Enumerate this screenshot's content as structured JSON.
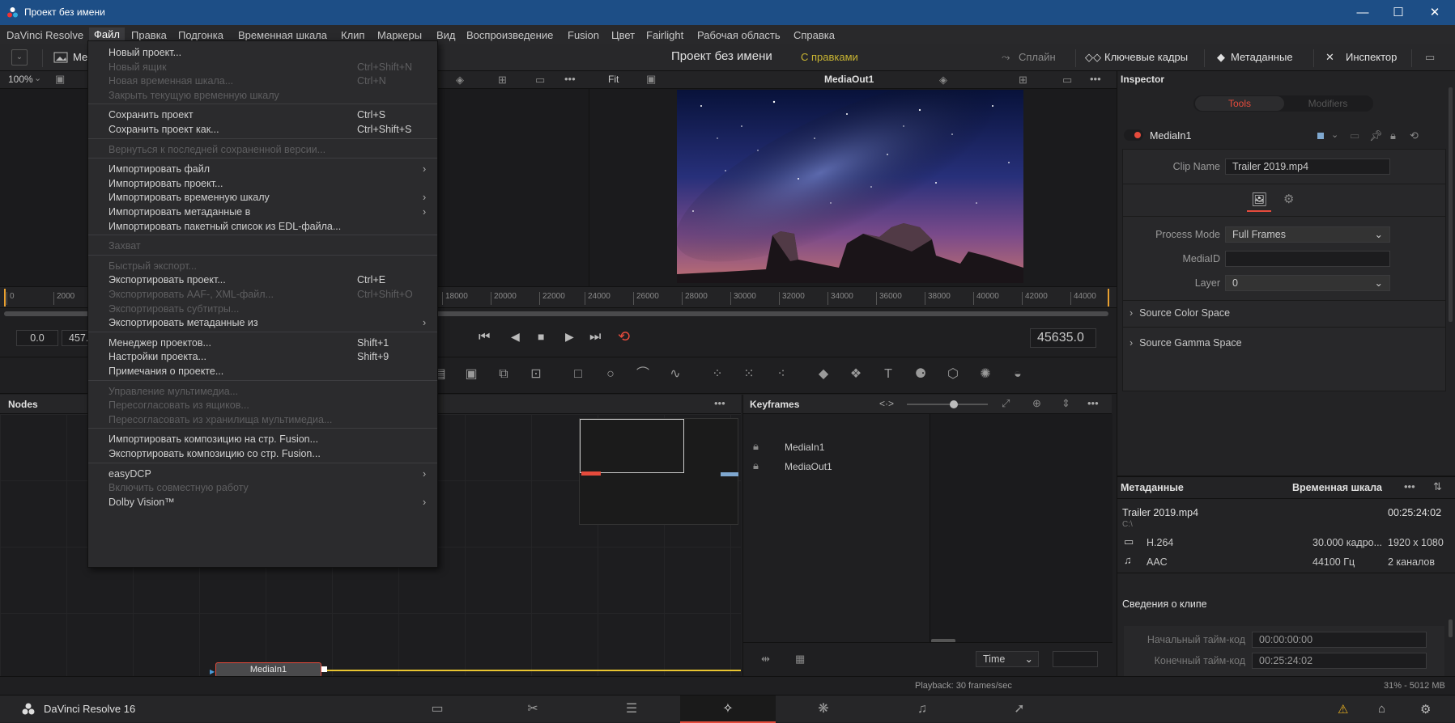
{
  "window": {
    "title": "Проект без имени",
    "min": "—",
    "max": "☐",
    "close": "✕"
  },
  "menu": [
    "DaVinci Resolve",
    "Файл",
    "Правка",
    "Подгонка",
    "Временная шкала",
    "Клип",
    "Маркеры",
    "Вид",
    "Воспроизведение",
    "Fusion",
    "Цвет",
    "Fairlight",
    "Рабочая область",
    "Справка"
  ],
  "toolbar": {
    "media_label": "Ме",
    "project_title": "Проект без имени",
    "edited": "С правками",
    "spline": "Сплайн",
    "keyframes": "Ключевые кадры",
    "metadata": "Метаданные",
    "inspector": "Инспектор"
  },
  "viewer": {
    "zoom": "100%",
    "fit": "Fit",
    "name": "MediaOut1"
  },
  "ruler": [
    "0",
    "2000",
    "18000",
    "20000",
    "22000",
    "24000",
    "26000",
    "28000",
    "30000",
    "32000",
    "34000",
    "36000",
    "38000",
    "40000",
    "42000",
    "44000"
  ],
  "transport": {
    "start": "0.0",
    "end": "457.",
    "timecode": "45635.0"
  },
  "nodes": {
    "title": "Nodes",
    "node": "MediaIn1"
  },
  "keyframes": {
    "title": "Keyframes",
    "items": [
      "MediaIn1",
      "MediaOut1"
    ],
    "time_mode": "Time",
    "toggle": "<·>"
  },
  "inspector": {
    "title": "Inspector",
    "tab_tools": "Tools",
    "tab_modifiers": "Modifiers",
    "node_name": "MediaIn1",
    "clip_name_label": "Clip Name",
    "clip_name": "Trailer 2019.mp4",
    "process_mode_label": "Process Mode",
    "process_mode": "Full Frames",
    "mediaid_label": "MediaID",
    "mediaid": "",
    "layer_label": "Layer",
    "layer": "0",
    "source_color": "Source Color Space",
    "source_gamma": "Source Gamma Space"
  },
  "metadata": {
    "title": "Метаданные",
    "timeline": "Временная шкала",
    "clip": "Trailer 2019.mp4",
    "duration": "00:25:24:02",
    "path": "C:\\",
    "video_codec": "H.264",
    "fps": "30.000 кадро...",
    "resolution": "1920 x 1080",
    "audio_codec": "AAC",
    "sample_rate": "44100 Гц",
    "channels": "2 каналов",
    "section": "Сведения о клипе",
    "start_tc_label": "Начальный тайм-код",
    "start_tc": "00:00:00:00",
    "end_tc_label": "Конечный тайм-код",
    "end_tc": "00:25:24:02"
  },
  "status": {
    "playback": "Playback: 30 frames/sec",
    "mem": "31% - 5012 MB",
    "app": "DaVinci Resolve 16"
  },
  "file_menu": [
    {
      "label": "Новый проект...",
      "shortcut": "",
      "enabled": true,
      "arrow": false
    },
    {
      "label": "Новый ящик",
      "shortcut": "Ctrl+Shift+N",
      "enabled": false,
      "arrow": false
    },
    {
      "label": "Новая временная шкала...",
      "shortcut": "Ctrl+N",
      "enabled": false,
      "arrow": false
    },
    {
      "label": "Закрыть текущую временную шкалу",
      "shortcut": "",
      "enabled": false,
      "arrow": false
    },
    {
      "sep": true
    },
    {
      "label": "Сохранить проект",
      "shortcut": "Ctrl+S",
      "enabled": true,
      "arrow": false
    },
    {
      "label": "Сохранить проект как...",
      "shortcut": "Ctrl+Shift+S",
      "enabled": true,
      "arrow": false
    },
    {
      "sep": true
    },
    {
      "label": "Вернуться к последней сохраненной версии...",
      "shortcut": "",
      "enabled": false,
      "arrow": false
    },
    {
      "sep": true
    },
    {
      "label": "Импортировать файл",
      "shortcut": "",
      "enabled": true,
      "arrow": true
    },
    {
      "label": "Импортировать проект...",
      "shortcut": "",
      "enabled": true,
      "arrow": false
    },
    {
      "label": "Импортировать временную шкалу",
      "shortcut": "",
      "enabled": true,
      "arrow": true
    },
    {
      "label": "Импортировать метаданные в",
      "shortcut": "",
      "enabled": true,
      "arrow": true
    },
    {
      "label": "Импортировать пакетный список из EDL-файла...",
      "shortcut": "",
      "enabled": true,
      "arrow": false
    },
    {
      "sep": true
    },
    {
      "label": "Захват",
      "shortcut": "",
      "enabled": false,
      "arrow": false
    },
    {
      "sep": true
    },
    {
      "label": "Быстрый экспорт...",
      "shortcut": "",
      "enabled": false,
      "arrow": false
    },
    {
      "label": "Экспортировать проект...",
      "shortcut": "Ctrl+E",
      "enabled": true,
      "arrow": false
    },
    {
      "label": "Экспортировать AAF-, XML-файл...",
      "shortcut": "Ctrl+Shift+O",
      "enabled": false,
      "arrow": false
    },
    {
      "label": "Экспортировать субтитры...",
      "shortcut": "",
      "enabled": false,
      "arrow": false
    },
    {
      "label": "Экспортировать метаданные из",
      "shortcut": "",
      "enabled": true,
      "arrow": true
    },
    {
      "sep": true
    },
    {
      "label": "Менеджер проектов...",
      "shortcut": "Shift+1",
      "enabled": true,
      "arrow": false
    },
    {
      "label": "Настройки проекта...",
      "shortcut": "Shift+9",
      "enabled": true,
      "arrow": false
    },
    {
      "label": "Примечания о проекте...",
      "shortcut": "",
      "enabled": true,
      "arrow": false
    },
    {
      "sep": true
    },
    {
      "label": "Управление мультимедиа...",
      "shortcut": "",
      "enabled": false,
      "arrow": false
    },
    {
      "label": "Пересогласовать из ящиков...",
      "shortcut": "",
      "enabled": false,
      "arrow": false
    },
    {
      "label": "Пересогласовать из хранилища мультимедиа...",
      "shortcut": "",
      "enabled": false,
      "arrow": false
    },
    {
      "sep": true
    },
    {
      "label": "Импортировать композицию на стр. Fusion...",
      "shortcut": "",
      "enabled": true,
      "arrow": false
    },
    {
      "label": "Экспортировать композицию со стр. Fusion...",
      "shortcut": "",
      "enabled": true,
      "arrow": false
    },
    {
      "sep": true
    },
    {
      "label": "easyDCP",
      "shortcut": "",
      "enabled": true,
      "arrow": true
    },
    {
      "label": "Включить совместную работу",
      "shortcut": "",
      "enabled": false,
      "arrow": false
    },
    {
      "label": "Dolby Vision™",
      "shortcut": "",
      "enabled": true,
      "arrow": true
    }
  ],
  "colors": {
    "accent": "#e64b3c",
    "titlebar": "#1d4e86",
    "yellow_edit": "#c8b432",
    "node_line": "#e8c430"
  }
}
